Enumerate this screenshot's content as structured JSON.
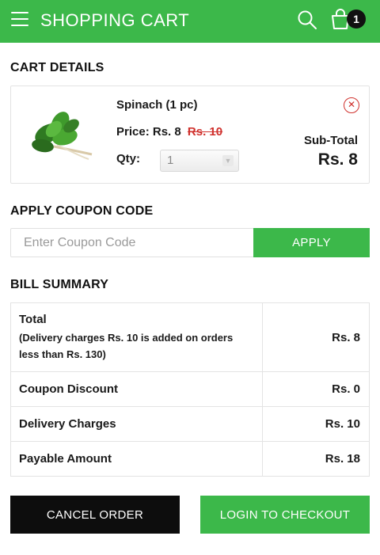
{
  "app": {
    "title": "SHOPPING CART",
    "cart_count": "1",
    "accent_color": "#3cb84a"
  },
  "cart": {
    "heading": "CART DETAILS",
    "item": {
      "name": "Spinach (1 pc)",
      "price_label": "Price:",
      "price": "Rs. 8",
      "old_price": "Rs. 10",
      "qty_label": "Qty:",
      "qty_value": "1",
      "subtotal_label": "Sub-Total",
      "subtotal": "Rs. 8"
    }
  },
  "coupon": {
    "heading": "APPLY COUPON CODE",
    "placeholder": "Enter Coupon Code",
    "apply_label": "APPLY"
  },
  "bill": {
    "heading": "BILL SUMMARY",
    "rows": [
      {
        "label": "Total",
        "note": "(Delivery charges Rs. 10 is added on orders less than Rs. 130)",
        "value": "Rs. 8"
      },
      {
        "label": "Coupon Discount",
        "value": "Rs. 0"
      },
      {
        "label": "Delivery Charges",
        "value": "Rs. 10"
      },
      {
        "label": "Payable Amount",
        "value": "Rs. 18"
      }
    ]
  },
  "actions": {
    "cancel_label": "CANCEL ORDER",
    "checkout_label": "LOGIN TO CHECKOUT"
  },
  "icons": {
    "menu": "menu-icon",
    "search": "search-icon",
    "cart": "shopping-bag-icon",
    "remove": "close-circle-icon",
    "dropdown": "chevron-down-icon"
  }
}
